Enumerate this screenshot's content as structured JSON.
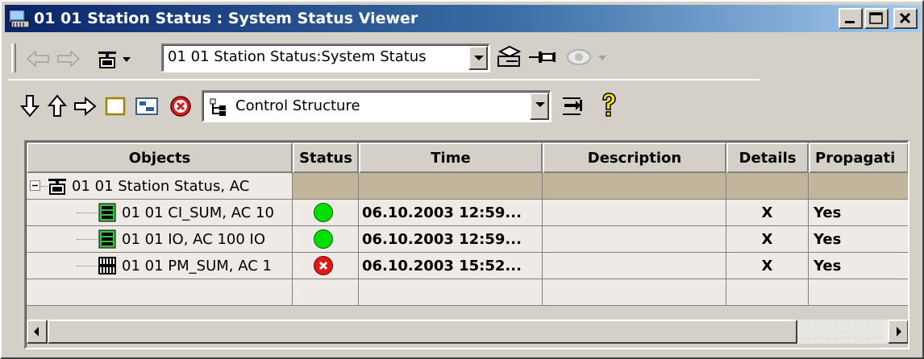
{
  "window": {
    "title": "01 01 Station Status : System Status Viewer"
  },
  "toolbar1": {
    "location_combo_value": "01 01   Station Status:System Status"
  },
  "toolbar2": {
    "structure_combo_value": "Control Structure"
  },
  "grid": {
    "columns": [
      "Objects",
      "Status",
      "Time",
      "Description",
      "Details",
      "Propagati"
    ],
    "parent_row": {
      "object": "01 01   Station Status, AC"
    },
    "rows": [
      {
        "object": "01 01 CI_SUM, AC 10",
        "status": "ok",
        "time": "06.10.2003 12:59...",
        "description": "",
        "details": "X",
        "propagation": "Yes"
      },
      {
        "object": "01 01 IO, AC 100 IO",
        "status": "ok",
        "time": "06.10.2003 12:59...",
        "description": "",
        "details": "X",
        "propagation": "Yes"
      },
      {
        "object": "01 01 PM_SUM, AC 1",
        "status": "error",
        "time": "06.10.2003 15:52...",
        "description": "",
        "details": "X",
        "propagation": "Yes"
      }
    ]
  },
  "colors": {
    "status_ok": "#00e000",
    "status_error": "#e01818",
    "parent_row_bg": "#c1b59b"
  },
  "icons": [
    "app-icon",
    "minimize-icon",
    "maximize-icon",
    "close-icon",
    "back-arrow-icon",
    "forward-arrow-icon",
    "object-type-icon",
    "print-preview-icon",
    "pin-icon",
    "eye-icon",
    "arrow-down-icon",
    "arrow-up-icon",
    "arrow-right-icon",
    "window-icon",
    "structure-view-icon",
    "stop-icon",
    "control-structure-icon",
    "sync-icon",
    "help-icon"
  ]
}
